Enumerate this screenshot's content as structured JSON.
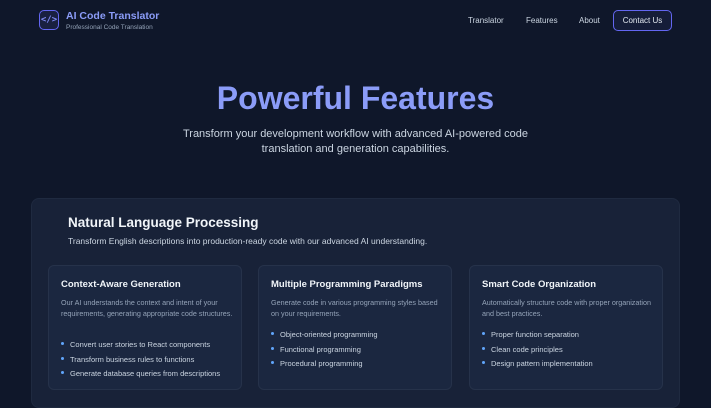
{
  "brand": {
    "logo": "</>",
    "title": "AI Code Translator",
    "subtitle": "Professional Code Translation"
  },
  "nav": {
    "links": [
      "Translator",
      "Features",
      "About"
    ],
    "cta": "Contact Us"
  },
  "hero": {
    "title": "Powerful Features",
    "subtitle": "Transform your development workflow with advanced AI-powered code translation and generation capabilities."
  },
  "section": {
    "title": "Natural Language Processing",
    "subtitle": "Transform English descriptions into production-ready code with our advanced AI understanding.",
    "cards": [
      {
        "title": "Context-Aware Generation",
        "desc": "Our AI understands the context and intent of your requirements, generating appropriate code structures.",
        "items": [
          "Convert user stories to React components",
          "Transform business rules to functions",
          "Generate database queries from descriptions"
        ]
      },
      {
        "title": "Multiple Programming Paradigms",
        "desc": "Generate code in various programming styles based on your requirements.",
        "items": [
          "Object-oriented programming",
          "Functional programming",
          "Procedural programming"
        ]
      },
      {
        "title": "Smart Code Organization",
        "desc": "Automatically structure code with proper organization and best practices.",
        "items": [
          "Proper function separation",
          "Clean code principles",
          "Design pattern implementation"
        ]
      }
    ]
  },
  "colors": {
    "background": "#0f172a",
    "accent": "#8b9cf8",
    "bullet": "#60a5fa"
  }
}
